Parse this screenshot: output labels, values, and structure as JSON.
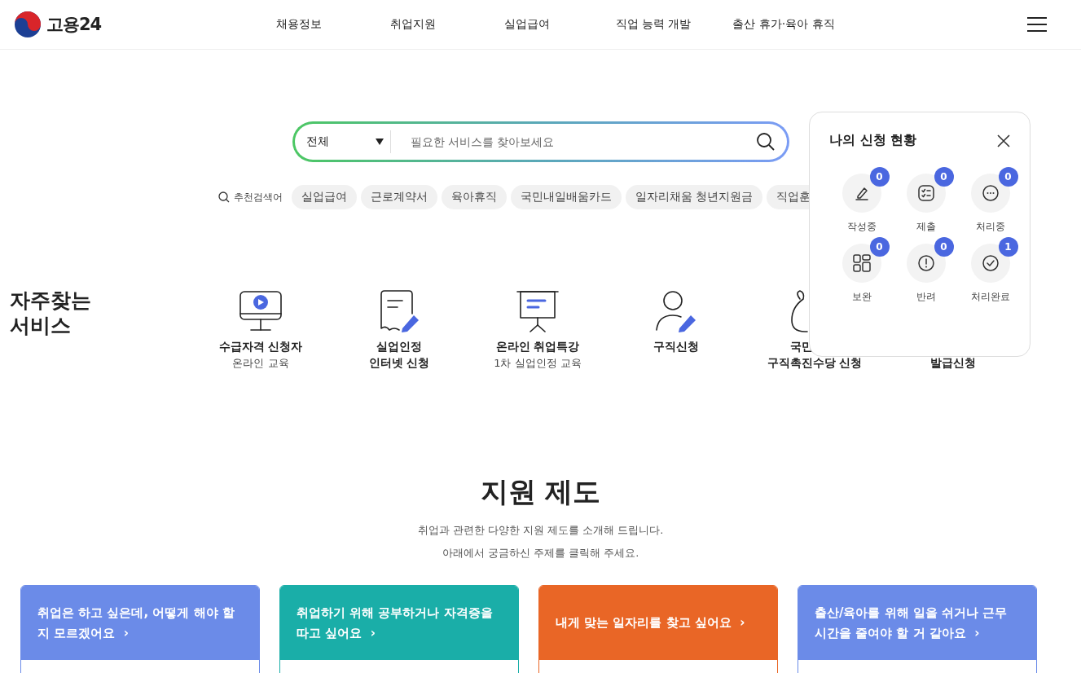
{
  "header": {
    "logo": "고용24",
    "nav": [
      "채용정보",
      "취업지원",
      "실업급여",
      "직업 능력 개발",
      "출산 휴가·육아 휴직"
    ]
  },
  "search": {
    "category": "전체",
    "placeholder": "필요한 서비스를 찾아보세요"
  },
  "recommended": {
    "label": "추천검색어",
    "keywords": [
      "실업급여",
      "근로계약서",
      "육아휴직",
      "국민내일배움카드",
      "일자리채움 청년지원금",
      "직업훈"
    ]
  },
  "frequent": {
    "title": "자주찾는 서비스",
    "services": [
      {
        "kind": "monitor",
        "title": "수급자격 신청자",
        "subtitle": "온라인 교육"
      },
      {
        "kind": "document",
        "title": "실업인정",
        "subtitle": "인터넷 신청"
      },
      {
        "kind": "board",
        "title": "온라인 취업특강",
        "subtitle": "1차 실업인정 교육"
      },
      {
        "kind": "person",
        "title": "구직신청"
      },
      {
        "kind": "bag",
        "title": "국민",
        "subtitle": "구직촉진수당 신청"
      },
      {
        "kind": "hidden",
        "subtitle": "발급신청"
      }
    ]
  },
  "status_panel": {
    "title": "나의 신청 현황",
    "items": [
      {
        "kind": "pencil",
        "label": "작성중",
        "count": "0"
      },
      {
        "kind": "checklist",
        "label": "제출",
        "count": "0"
      },
      {
        "kind": "dots",
        "label": "처리중",
        "count": "0"
      },
      {
        "kind": "grid",
        "label": "보완",
        "count": "0"
      },
      {
        "kind": "alert",
        "label": "반려",
        "count": "0"
      },
      {
        "kind": "check",
        "label": "처리완료",
        "count": "1"
      }
    ]
  },
  "support": {
    "title": "지원 제도",
    "description": [
      "취업과 관련한 다양한 지원 제도를 소개해 드립니다.",
      "아래에서 궁금하신 주제를 클릭해 주세요."
    ],
    "cards": [
      {
        "text": "취업은 하고 싶은데, 어떻게 해야 할 지 모르겠어요",
        "arrow": "›",
        "color": "#6b8be8"
      },
      {
        "text": "취업하기 위해 공부하거나 자격증을 따고 싶어요",
        "arrow": "›",
        "color": "#1aaea8"
      },
      {
        "text": "내게 맞는 일자리를 찾고 싶어요",
        "arrow": "›",
        "color": "#e96626"
      },
      {
        "text": "출산/육아를 위해 일을 쉬거나 근무 시간을 줄여야 할 거 같아요",
        "arrow": "›",
        "color": "#6b8be8"
      }
    ]
  }
}
